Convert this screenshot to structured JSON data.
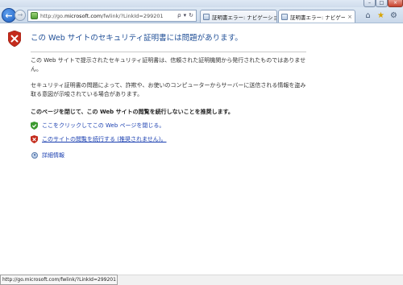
{
  "browser": {
    "address": {
      "prefix": "http://go.",
      "domain": "microsoft.com",
      "suffix": "/fwlink/?LinkId=299201"
    },
    "address_tools": {
      "search_glyph": "ρ",
      "dropdown_glyph": "▾",
      "refresh_glyph": "↻"
    },
    "tabs": [
      {
        "label": "証明書エラー: ナビゲーショ...",
        "active": false
      },
      {
        "label": "証明書エラー: ナビゲーショ...",
        "active": true
      }
    ],
    "tab_close_glyph": "×",
    "toolbar_icons": [
      "home-icon",
      "favorites-star-icon",
      "gear-icon"
    ],
    "window_controls": {
      "minimize": "–",
      "maximize": "□",
      "close": "×"
    }
  },
  "page": {
    "headline": "この Web サイトのセキュリティ証明書には問題があります。",
    "paragraphs": [
      "この Web サイトで提示されたセキュリティ証明書は、信頼された証明機関から発行されたものではありません。",
      "セキュリティ証明書の問題によって、詐欺や、お使いのコンピューターからサーバーに送信される情報を盗み取る意図が示唆されている場合があります。"
    ],
    "recommendation": "このページを閉じて、この Web サイトの閲覧を続行しないことを推奨します。",
    "choices": [
      {
        "label": "ここをクリックしてこの Web ページを閉じる。",
        "icon": "green-check-shield-icon"
      },
      {
        "label": "このサイトの閲覧を続行する (推奨されません)。",
        "icon": "red-x-shield-icon"
      }
    ],
    "details_label": "詳細情報"
  },
  "status": {
    "url": "http://go.microsoft.com/fwlink/?LinkId=299201"
  },
  "colors": {
    "headline": "#1f4e96",
    "link": "#1a3fb0",
    "shield_red": "#c42b1c"
  }
}
